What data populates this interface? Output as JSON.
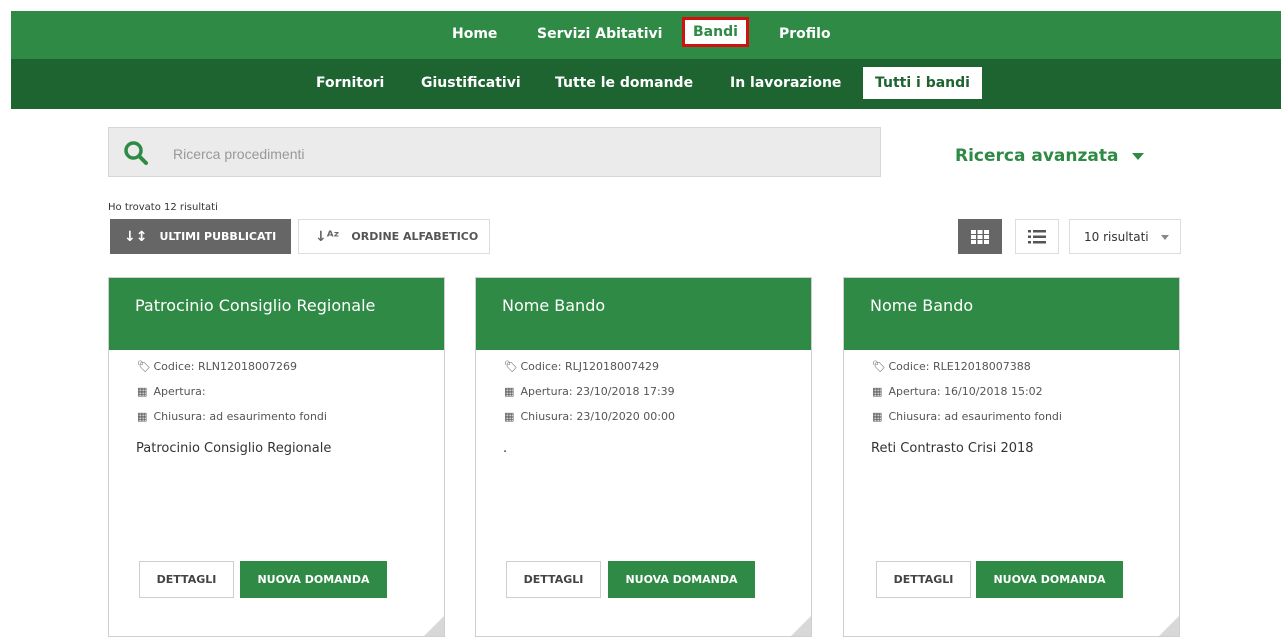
{
  "nav": {
    "primary": [
      "Home",
      "Servizi Abitativi",
      "Bandi",
      "Profilo"
    ],
    "secondary": [
      "Fornitori",
      "Giustificativi",
      "Tutte le domande",
      "In lavorazione",
      "Tutti i bandi"
    ]
  },
  "search": {
    "placeholder": "Ricerca procedimenti",
    "icon": "search-icon",
    "advanced_label": "Ricerca avanzata"
  },
  "results": {
    "found_text": "Ho trovato 12 risultati",
    "sort_recent": "ULTIMI PUBBLICATI",
    "sort_alpha": "ORDINE ALFABETICO",
    "per_page": "10 risultati"
  },
  "colors": {
    "primary": "#2f8a45",
    "dark": "#1e6431",
    "highlight": "#d11010"
  },
  "cards": [
    {
      "title": "Patrocinio Consiglio Regionale",
      "codice_label": "Codice:",
      "codice": "RLN12018007269",
      "apertura_label": "Apertura:",
      "apertura": "",
      "chiusura_label": "Chiusura:",
      "chiusura": "ad esaurimento fondi",
      "description": "Patrocinio Consiglio Regionale",
      "details_label": "DETTAGLI",
      "new_label": "NUOVA DOMANDA"
    },
    {
      "title": "Nome Bando",
      "codice_label": "Codice:",
      "codice": "RLJ12018007429",
      "apertura_label": "Apertura:",
      "apertura": "23/10/2018 17:39",
      "chiusura_label": "Chiusura:",
      "chiusura": "23/10/2020 00:00",
      "description": ".",
      "details_label": "DETTAGLI",
      "new_label": "NUOVA DOMANDA"
    },
    {
      "title": "Nome Bando",
      "codice_label": "Codice:",
      "codice": "RLE12018007388",
      "apertura_label": "Apertura:",
      "apertura": "16/10/2018 15:02",
      "chiusura_label": "Chiusura:",
      "chiusura": "ad esaurimento fondi",
      "description": "Reti Contrasto Crisi 2018",
      "details_label": "DETTAGLI",
      "new_label": "NUOVA DOMANDA"
    }
  ]
}
